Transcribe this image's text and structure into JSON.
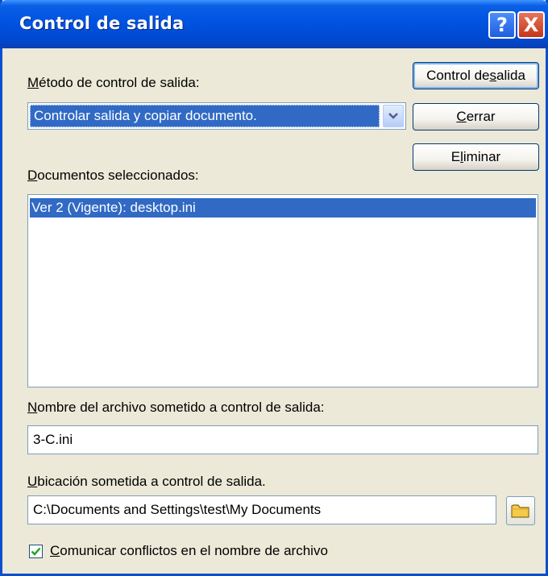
{
  "window": {
    "title": "Control de salida"
  },
  "titlebar": {
    "help_label": "?",
    "close_label": "X"
  },
  "method": {
    "label_prefix": "",
    "label_accel": "M",
    "label_rest": "étodo de control de salida:",
    "selected": "Controlar salida y copiar documento."
  },
  "buttons": {
    "checkout_pre": "Control de ",
    "checkout_accel": "s",
    "checkout_post": "alida",
    "close_accel": "C",
    "close_rest": "errar",
    "delete_pre": "E",
    "delete_accel": "l",
    "delete_post": "iminar"
  },
  "documents": {
    "label_accel": "D",
    "label_rest": "ocumentos seleccionados:",
    "items": [
      "Ver  2 (Vigente): desktop.ini"
    ]
  },
  "filename": {
    "label_accel": "N",
    "label_rest": "ombre del archivo sometido a control de salida:",
    "value": "3-C.ini"
  },
  "location": {
    "label_accel": "U",
    "label_rest": "bicación sometida a control de salida.",
    "value": "C:\\Documents and Settings\\test\\My Documents"
  },
  "conflicts": {
    "checked": true,
    "label_accel": "C",
    "label_rest": "omunicar conflictos en el nombre de archivo"
  },
  "icons": {
    "help": "help-icon",
    "close": "close-icon",
    "dropdown": "chevron-down-icon",
    "folder": "folder-icon",
    "check": "check-icon"
  },
  "colors": {
    "titlebar": "#0053E1",
    "selection": "#316AC5",
    "dialog_bg": "#ECE9D8",
    "close_button": "#C4361C"
  }
}
